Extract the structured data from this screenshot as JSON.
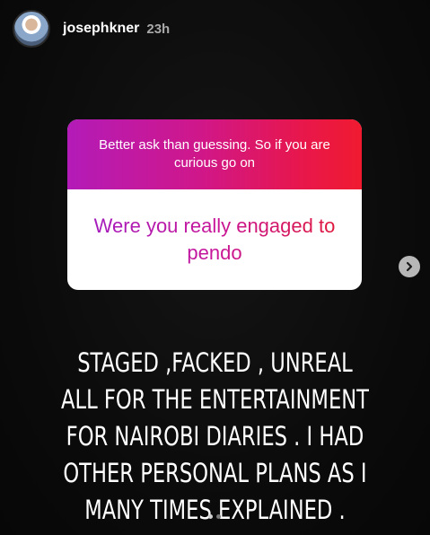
{
  "story": {
    "username": "josephkner",
    "time_ago": "23h"
  },
  "question_sticker": {
    "prompt": "Better ask than guessing. So if you are curious go on",
    "answer": "Were you really engaged to pendo"
  },
  "caption_lines": [
    "STAGED ,FACKED , UNREAL",
    "ALL FOR THE ENTERTAINMENT",
    "FOR NAIROBI DIARIES . I HAD",
    "OTHER PERSONAL PLANS AS I",
    "MANY TIMES EXPLAINED ."
  ],
  "icons": {
    "next": "chevron-right-icon"
  },
  "colors": {
    "gradient_start": "#b31bb8",
    "gradient_end": "#f01a30",
    "background": "#0b0b0b"
  }
}
